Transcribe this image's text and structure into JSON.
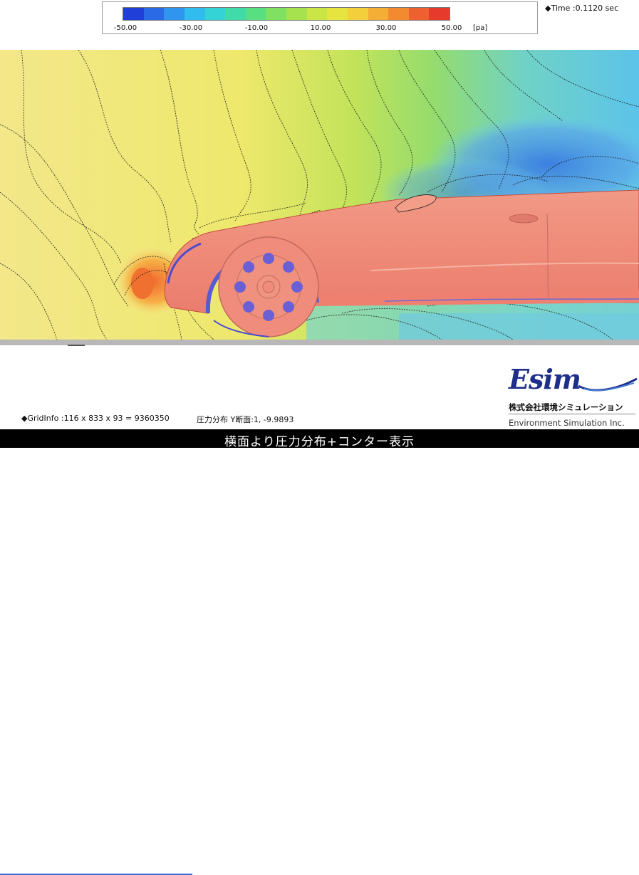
{
  "colorbar": {
    "colors": [
      "#1f3fd8",
      "#2a6ae6",
      "#2f95ee",
      "#30bcee",
      "#33d3d6",
      "#3fdcaa",
      "#58df82",
      "#7fe061",
      "#a6e24e",
      "#c9e646",
      "#e6e43f",
      "#f3cf3b",
      "#f5ae35",
      "#f48a2f",
      "#ee6030",
      "#e53a2c"
    ],
    "ticks": [
      "-50.00",
      "-30.00",
      "-10.00",
      "10.00",
      "30.00",
      "50.00"
    ],
    "unit": "[pa]"
  },
  "time": "◆Time :0.1120  sec",
  "footer": {
    "grid_info": "◆GridInfo :116 x 833 x 93 = 9360350",
    "slice_info": "圧力分布 Y断面:1, -9.9893"
  },
  "logo": {
    "mark": "Esim",
    "japanese": "株式会社環境シミュレーション",
    "english": "Environment Simulation Inc."
  },
  "caption": "横面より圧力分布+コンター表示",
  "colors": {
    "field_yellow": "#f3ea7a",
    "field_green": "#a9e07a",
    "field_cyan": "#68cfe6",
    "car_body": "#f08a78",
    "wheel_blue": "#6b6bd6"
  }
}
